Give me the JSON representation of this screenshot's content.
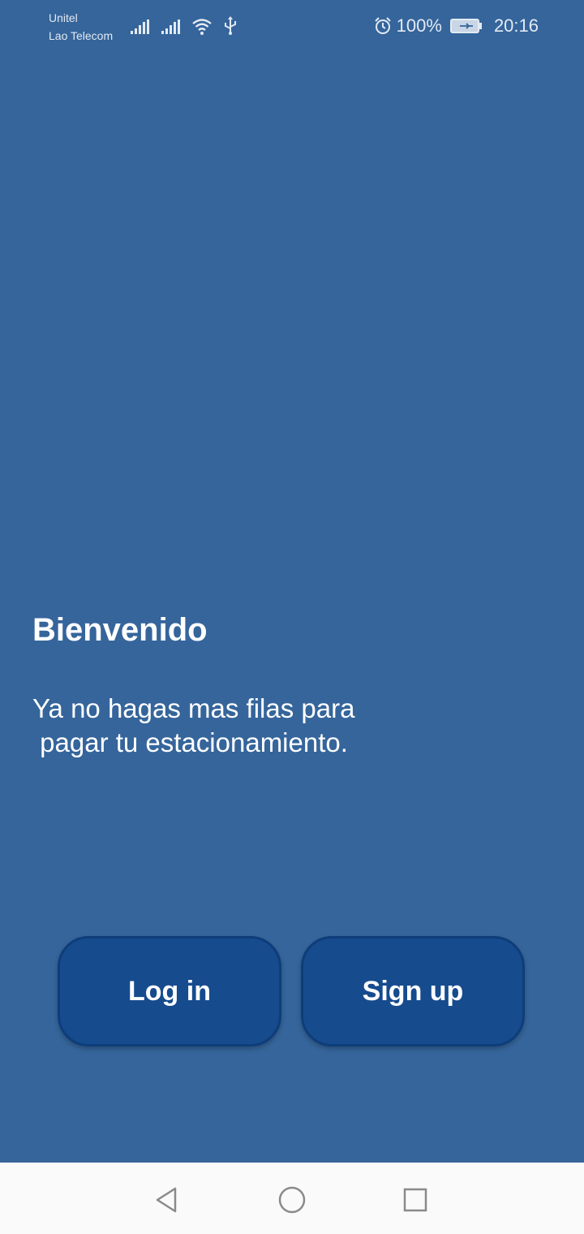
{
  "status_bar": {
    "carrier_1": "Unitel",
    "carrier_2": "Lao Telecom",
    "battery_percent": "100%",
    "time": "20:16",
    "icons": [
      "signal-icon",
      "signal-icon",
      "wifi-icon",
      "usb-icon",
      "alarm-icon",
      "battery-icon"
    ]
  },
  "welcome": {
    "title": "Bienvenido",
    "line_1": "Ya no hagas mas filas para",
    "line_2": " pagar tu estacionamiento."
  },
  "buttons": {
    "login_label": "Log in",
    "signup_label": "Sign up"
  },
  "nav_bar": {
    "icons": [
      "back-icon",
      "home-icon",
      "recent-apps-icon"
    ]
  },
  "colors": {
    "background": "#35659b",
    "button": "#164b8e",
    "nav_bar": "#fafafa"
  }
}
